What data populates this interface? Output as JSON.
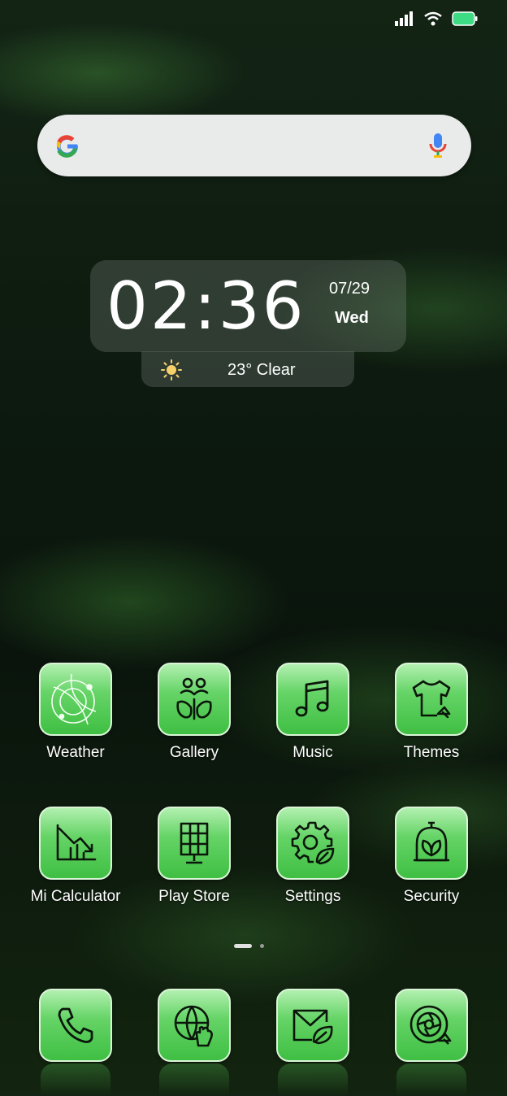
{
  "status_bar": {
    "signal_icon": "cellular-signal-icon",
    "wifi_icon": "wifi-icon",
    "battery_icon": "battery-icon",
    "battery_color": "#3ddc84"
  },
  "search": {
    "logo_icon": "google-g-icon",
    "mic_icon": "microphone-icon",
    "placeholder": ""
  },
  "clock_widget": {
    "time": "02:36",
    "date": "07/29",
    "weekday": "Wed"
  },
  "weather": {
    "icon": "sun-icon",
    "text": "23° Clear"
  },
  "apps": [
    {
      "label": "Weather",
      "icon": "weather-radar-icon"
    },
    {
      "label": "Gallery",
      "icon": "gallery-people-icon"
    },
    {
      "label": "Music",
      "icon": "music-note-icon"
    },
    {
      "label": "Themes",
      "icon": "tshirt-icon"
    },
    {
      "label": "Mi Calculator",
      "icon": "trending-down-chart-icon"
    },
    {
      "label": "Play Store",
      "icon": "grid-panel-icon"
    },
    {
      "label": "Settings",
      "icon": "gear-leaf-icon"
    },
    {
      "label": "Security",
      "icon": "shield-leaf-icon"
    }
  ],
  "dock": [
    {
      "icon": "phone-icon"
    },
    {
      "icon": "globe-hand-icon"
    },
    {
      "icon": "mail-leaf-icon"
    },
    {
      "icon": "camera-shutter-icon"
    }
  ],
  "page_indicator": {
    "pages": 2,
    "current": 1
  },
  "colors": {
    "icon_green": "#4fcb52",
    "icon_highlight": "#b2f0b0",
    "wallpaper_dark": "#0d1a0f"
  }
}
